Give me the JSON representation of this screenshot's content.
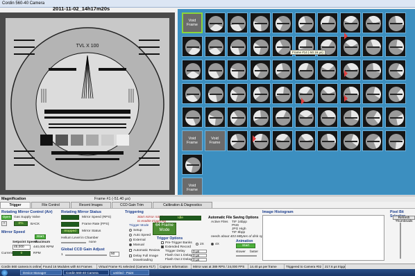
{
  "window": {
    "title": "Cordin 560-40 Camera"
  },
  "frame_stamp": "2011-11-02_14h17m20s",
  "main_image": {
    "label": "TVL X 100"
  },
  "thumbs": {
    "void_label": "Void Frame",
    "tooltip": "Frame #14 (-50.16 µs)"
  },
  "magnification": {
    "label": "Magnification",
    "frame_label": "Frame #1 (-51.40 µs)"
  },
  "tabs": [
    "Trigger",
    "File Control",
    "Recent Images",
    "CCD Gain Trim",
    "Calibration & Diagnostics"
  ],
  "controls": {
    "rotating_mirror_control": "Rotating Mirror Control (Air)",
    "open_btn": "Open",
    "gas_supply": "Gas Supply Valve",
    "gas_value": "0%",
    "gas_unit": "BACK",
    "mirror_speed": "Mirror Speed",
    "start_btn": "Start",
    "setpoint_speed": "Setpoint Speed",
    "maximum": "Maximum",
    "setpoint_value": "45,000",
    "max_value": "440,000 RPM",
    "current_label": "Current",
    "current_value": "0",
    "rpm": "RPM",
    "rotating_mirror_status": "Rotating Mirror Status",
    "mirror_speed_fps": "Mirror Speed (RPS)",
    "frame_rate": "Frame Rate (FPS)",
    "mirror_status": "Mirror Status",
    "stopped": "Stopped",
    "helium_level": "Helium Level in Chamber",
    "helium_value": "none",
    "global_ccd": "Global CCD Gain Adjust",
    "gain_min": "1",
    "gain_value": "50",
    "triggering": "Triggering",
    "start_note": "Start mirror rotation to enable triggering",
    "trigger_mode": "Trigger Mode",
    "setup": "Setup",
    "auto_speed": "Auto Speed",
    "external": "External",
    "manual": "Manual",
    "state_label": "Idle",
    "frame_mode": "64 Frame Mode",
    "auto_review": "Automatic Review",
    "delay_full_image": "Delay Full Image Downloading",
    "trigger_options": "Trigger Options",
    "pre_trigger": "Pre-Trigger Banks",
    "extended_record": "Extended Record",
    "trigger_delay": "Trigger Delay",
    "flash_out1": "Flash Out 1 Delay",
    "flash_out2": "Flash Out 2 Delay",
    "delay_unit": "0 µs",
    "x_opt": "2X",
    "x4_opt": "4X",
    "auto_file": "Automatic File Saving Options",
    "active_files": "Active Files",
    "tif": "TIF 16bpp",
    "png": "PNG",
    "jpg": "JPG High",
    "tif8": "TIF 8bpp",
    "needs": "needs about 403 MBytes of disk space",
    "animation": "Animation",
    "anim_start": "Start",
    "slower": "slower",
    "faster": "faster",
    "image_histogram": "Image Histogram",
    "pixel_bit": "Pixel Bit Selection",
    "refresh": "Refresh Thumbnails"
  },
  "status": [
    "Cordin 560 camera is online",
    "Found 16 Modules with 64 Frames",
    "Virtual Frame #1 selected (Camera #17)",
    "Capture Information",
    "Mirror was at 389 RPS / 24,000 FPS",
    "14.40 µs per frame",
    "Triggered to Camera #02",
    "217.6 µs trigger displacement"
  ],
  "taskbar": [
    "Device Manager",
    "Cordin 560-40 Camera",
    "untitled - Paint"
  ],
  "colors": {
    "thumb_bg": "#3c8fc0",
    "accent_green": "#4caf3c",
    "marker_red": "#e04040"
  }
}
